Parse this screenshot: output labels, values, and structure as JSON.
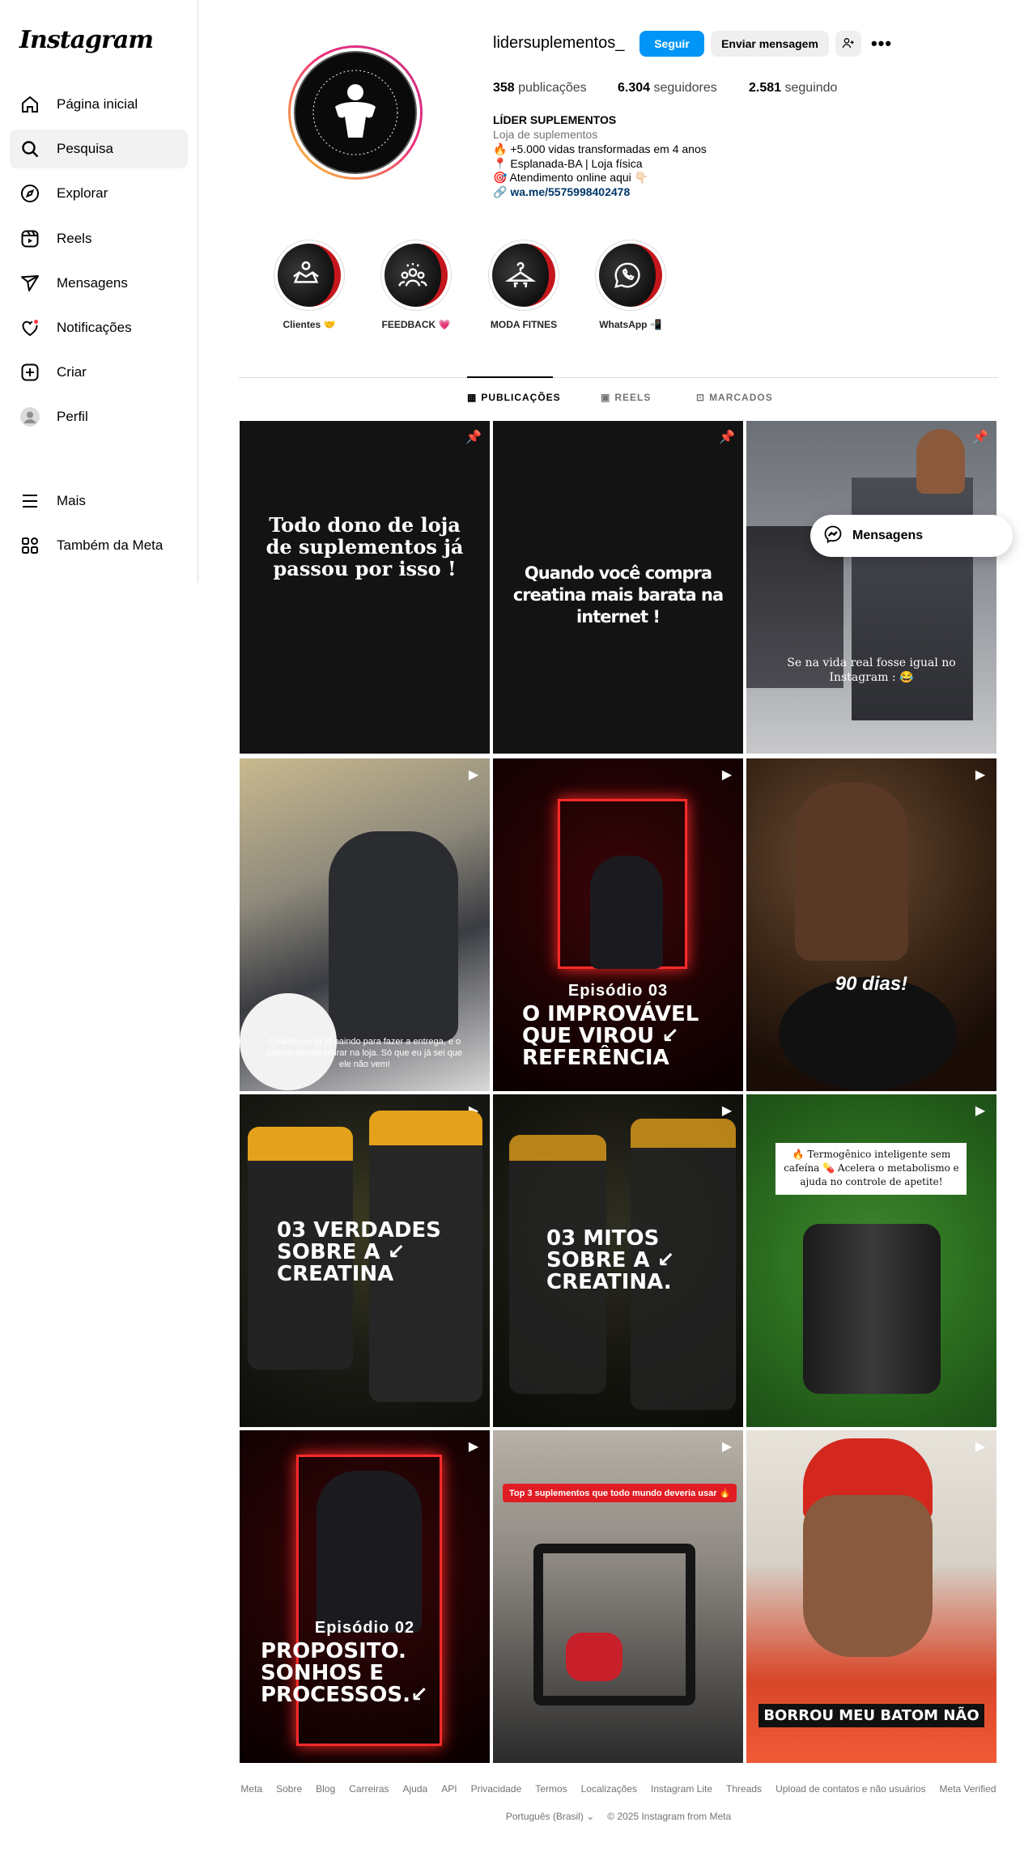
{
  "app": {
    "logo": "Instagram"
  },
  "sidebar": {
    "items": [
      {
        "label": "Página inicial",
        "icon": "home-icon"
      },
      {
        "label": "Pesquisa",
        "icon": "search-icon"
      },
      {
        "label": "Explorar",
        "icon": "compass-icon"
      },
      {
        "label": "Reels",
        "icon": "reels-icon"
      },
      {
        "label": "Mensagens",
        "icon": "send-icon"
      },
      {
        "label": "Notificações",
        "icon": "heart-icon"
      },
      {
        "label": "Criar",
        "icon": "plus-square-icon"
      },
      {
        "label": "Perfil",
        "icon": "avatar-icon"
      }
    ],
    "more": "Mais",
    "meta": "Também da Meta"
  },
  "profile": {
    "username": "lidersuplementos_",
    "follow_label": "Seguir",
    "message_label": "Enviar mensagem",
    "stats": {
      "posts_count": "358",
      "posts_label": "publicações",
      "followers_count": "6.304",
      "followers_label": "seguidores",
      "following_count": "2.581",
      "following_label": "seguindo"
    },
    "full_name": "LÍDER SUPLEMENTOS",
    "category": "Loja de suplementos",
    "bio": [
      "🔥 +5.000 vidas transformadas em 4 anos",
      "📍 Esplanada-BA | Loja física",
      "🎯 Atendimento online aqui 👇🏻"
    ],
    "link": "wa.me/5575998402478"
  },
  "highlights": [
    {
      "label": "Clientes 🤝"
    },
    {
      "label": "FEEDBACK 💗"
    },
    {
      "label": "MODA FITNES"
    },
    {
      "label": "WhatsApp 📲"
    }
  ],
  "tabs": [
    {
      "label": "PUBLICAÇÕES"
    },
    {
      "label": "REELS"
    },
    {
      "label": "MARCADOS"
    }
  ],
  "posts": [
    {
      "text": "Todo dono de loja de suplementos já passou por isso !"
    },
    {
      "text": "Quando você compra creatina mais barata na internet !"
    },
    {
      "text": "Se na vida real fosse igual no Instagram : 😂"
    },
    {
      "text": "Quando eu já tô saindo para fazer a entrega, e o cliente decide retirar na loja. Só que eu já sei que ele não vem!"
    },
    {
      "pre": "Episódio 03",
      "text": "O IMPROVÁVEL QUE VIROU ↙ REFERÊNCIA"
    },
    {
      "text": "90 dias!"
    },
    {
      "text": "03 VERDADES SOBRE A ↙ CREATINA"
    },
    {
      "text": "03 MITOS SOBRE A ↙ CREATINA."
    },
    {
      "text": "🔥 Termogênico inteligente sem cafeína 💊 Acelera o metabolismo e ajuda no controle de apetite!"
    },
    {
      "pre": "Episódio 02",
      "text": "PROPOSITO. SONHOS E PROCESSOS.↙"
    },
    {
      "text": "Top 3 suplementos que todo mundo deveria usar 🔥"
    },
    {
      "text": "BORROU MEU BATOM NÃO"
    }
  ],
  "floating": {
    "messages_label": "Mensagens"
  },
  "footer": {
    "links": [
      "Meta",
      "Sobre",
      "Blog",
      "Carreiras",
      "Ajuda",
      "API",
      "Privacidade",
      "Termos",
      "Localizações",
      "Instagram Lite",
      "Threads",
      "Upload de contatos e não usuários",
      "Meta Verified"
    ],
    "language": "Português (Brasil)",
    "copyright": "© 2025 Instagram from Meta"
  },
  "colors": {
    "accent": "#0095f6",
    "notification": "#ff3040",
    "link": "#00376b"
  }
}
